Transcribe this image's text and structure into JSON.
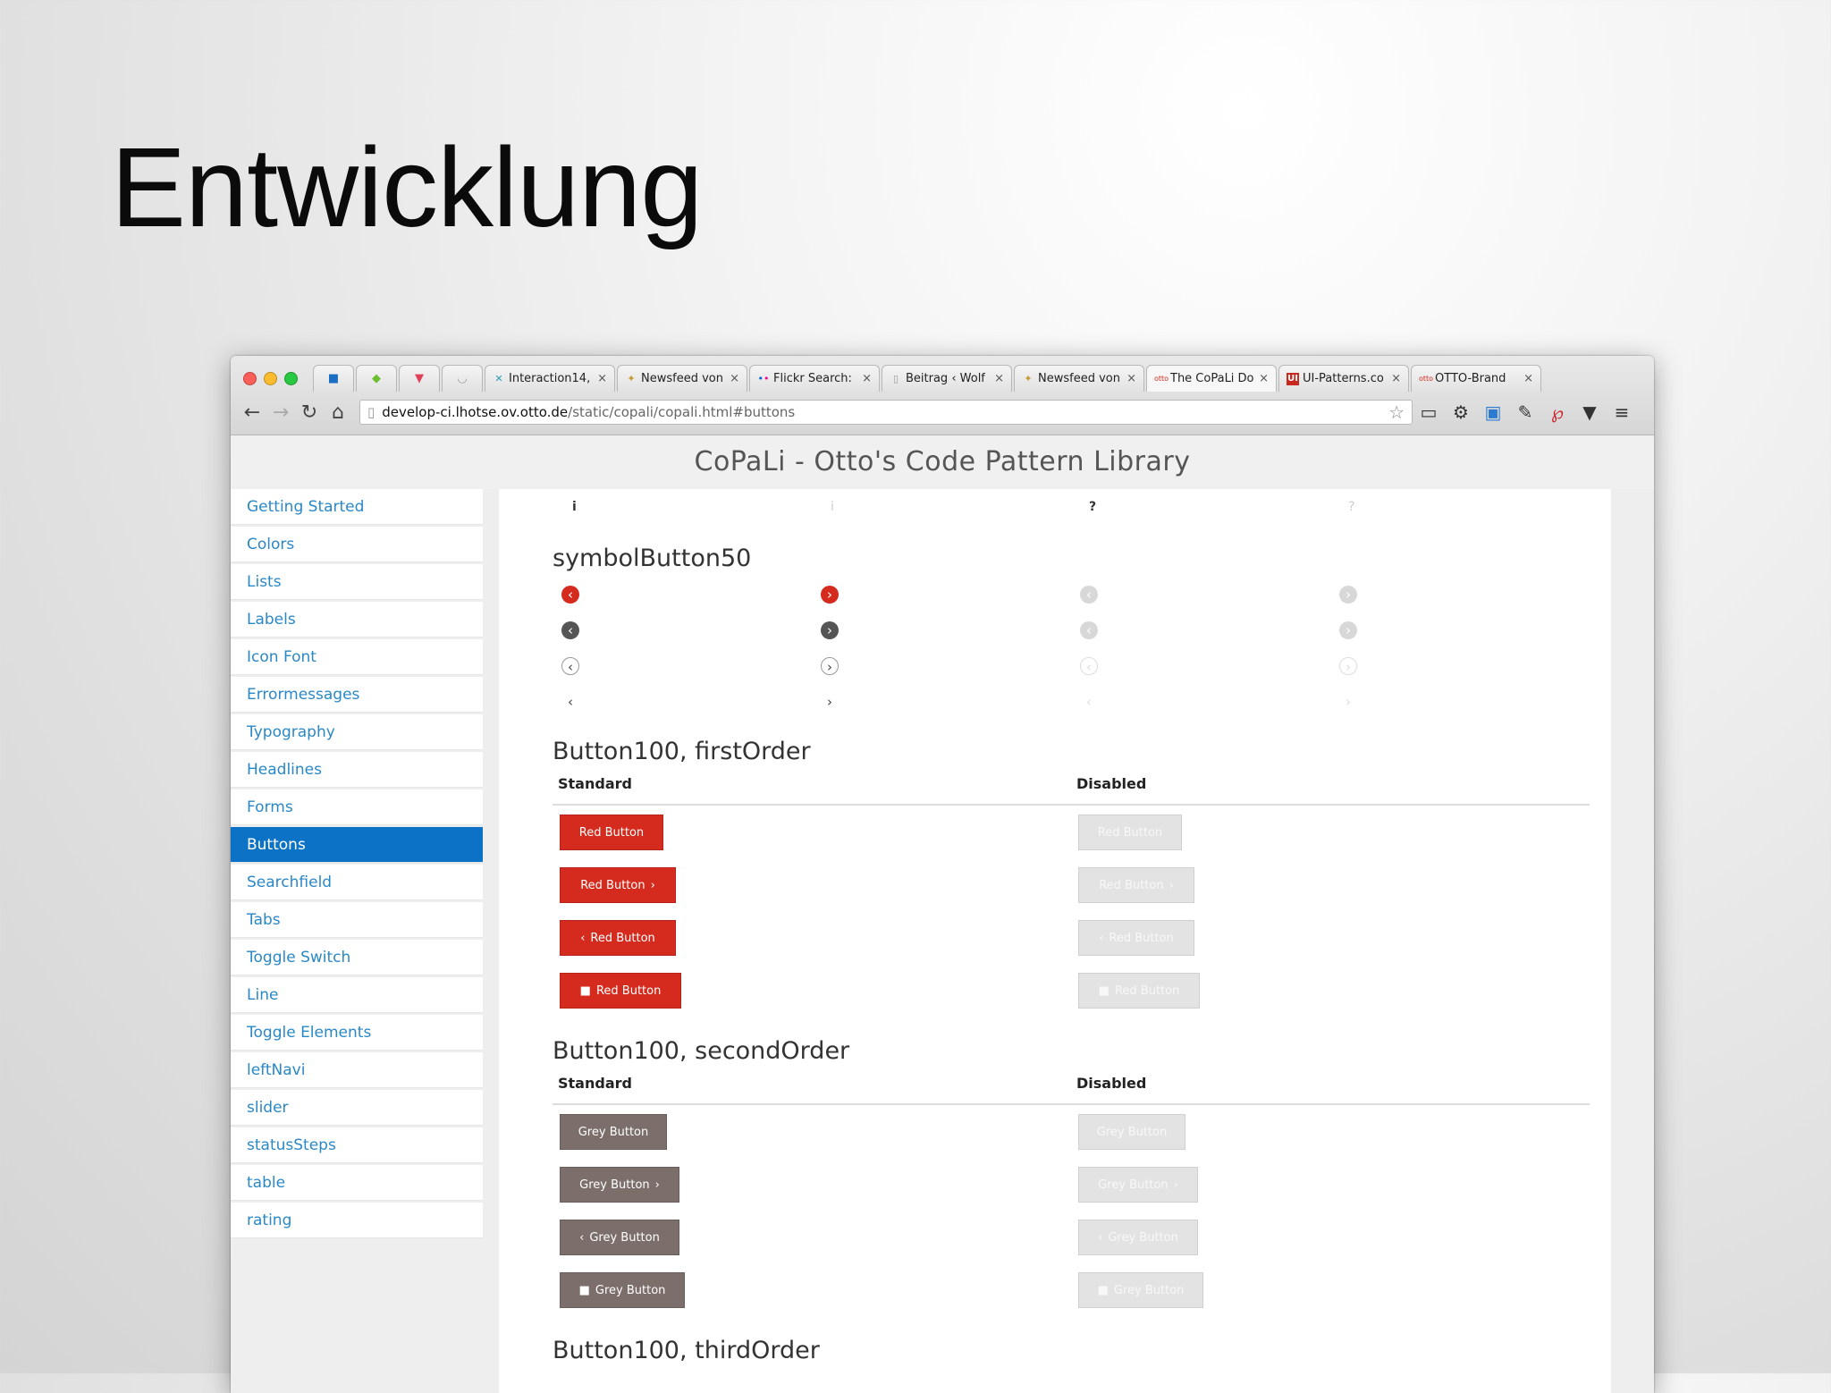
{
  "slide": {
    "title": "Entwicklung"
  },
  "browser": {
    "pinned_tabs": [
      "twitter-icon",
      "feedly-icon",
      "pocket-icon",
      "loading-icon"
    ],
    "tabs": [
      {
        "label": "Interaction14,",
        "icon": "x-icon"
      },
      {
        "label": "Newsfeed von",
        "icon": "puzzle-icon"
      },
      {
        "label": "Flickr Search:",
        "icon": "flickr-icon"
      },
      {
        "label": "Beitrag ‹ Wolf",
        "icon": "page-icon"
      },
      {
        "label": "Newsfeed von",
        "icon": "puzzle-icon"
      },
      {
        "label": "The CoPaLi Do",
        "icon": "otto-icon"
      },
      {
        "label": "UI-Patterns.co",
        "icon": "ui-icon"
      },
      {
        "label": "OTTO-Brand",
        "icon": "otto-icon"
      }
    ],
    "url_host": "develop-ci.lhotse.ov.otto.de",
    "url_path": "/static/copali/copali.html#buttons",
    "colors": {
      "accent_red": "#d52b1e",
      "nav_active": "#0b72c6",
      "link": "#2a88c6",
      "grey_button": "#7c6f6b"
    }
  },
  "app": {
    "title": "CoPaLi - Otto's Code Pattern Library",
    "nav": [
      "Getting Started",
      "Colors",
      "Lists",
      "Labels",
      "Icon Font",
      "Errormessages",
      "Typography",
      "Headlines",
      "Forms",
      "Buttons",
      "Searchfield",
      "Tabs",
      "Toggle Switch",
      "Line",
      "Toggle Elements",
      "leftNavi",
      "slider",
      "statusSteps",
      "table",
      "rating"
    ],
    "nav_active": "Buttons",
    "top_glyphs": [
      "i",
      "i",
      "?",
      "?"
    ],
    "symbol_section": {
      "title": "symbolButton50"
    },
    "first_order": {
      "title": "Button100, firstOrder",
      "col_standard": "Standard",
      "col_disabled": "Disabled",
      "buttons": [
        "Red Button",
        "Red Button",
        "Red Button",
        "Red Button"
      ]
    },
    "second_order": {
      "title": "Button100, secondOrder",
      "col_standard": "Standard",
      "col_disabled": "Disabled",
      "buttons": [
        "Grey Button",
        "Grey Button",
        "Grey Button",
        "Grey Button"
      ]
    },
    "third_order": {
      "title": "Button100, thirdOrder"
    }
  }
}
